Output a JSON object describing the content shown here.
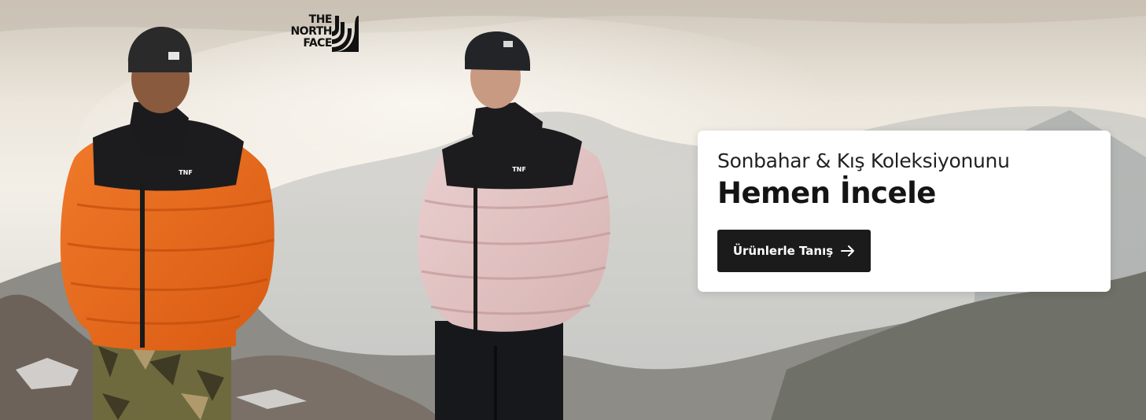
{
  "banner": {
    "brand": {
      "line1": "THE",
      "line2": "NORTH",
      "line3": "FACE",
      "icon": "half-dome-logo-icon"
    },
    "promo": {
      "subtitle": "Sonbahar & Kış Koleksiyonunu",
      "title": "Hemen İncele",
      "cta_label": "Ürünlerle Tanış",
      "cta_icon": "arrow-right-icon"
    },
    "colors": {
      "card_bg": "#ffffff",
      "button_bg": "#1b1b1b",
      "button_text": "#ffffff",
      "title_text": "#141414"
    }
  }
}
